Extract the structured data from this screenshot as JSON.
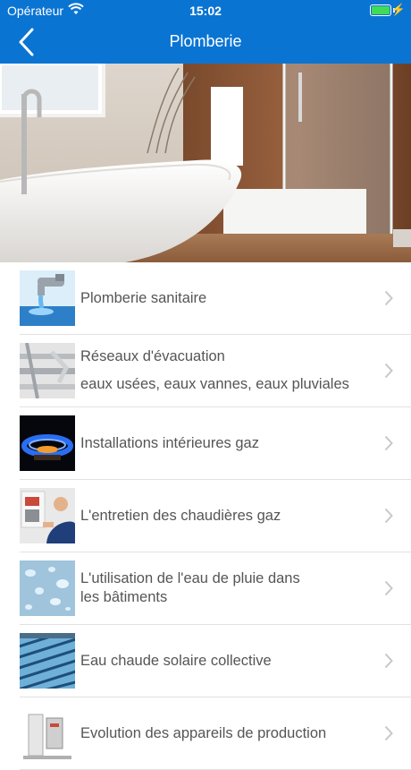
{
  "status_bar": {
    "carrier": "Opérateur",
    "time": "15:02"
  },
  "header": {
    "title": "Plomberie"
  },
  "items": [
    {
      "lines": [
        "Plomberie sanitaire"
      ],
      "icon": "faucet-water-icon"
    },
    {
      "lines": [
        "Réseaux d'évacuation",
        "eaux usées, eaux vannes, eaux pluviales"
      ],
      "icon": "pipes-icon"
    },
    {
      "lines": [
        "Installations intérieures gaz"
      ],
      "icon": "gas-flame-icon"
    },
    {
      "lines": [
        "L'entretien des chaudières gaz"
      ],
      "icon": "technician-boiler-icon"
    },
    {
      "lines": [
        "L'utilisation de l'eau de pluie dans",
        "les bâtiments"
      ],
      "icon": "water-drops-icon"
    },
    {
      "lines": [
        "Eau chaude solaire collective"
      ],
      "icon": "solar-panel-icon"
    },
    {
      "lines": [
        "Evolution des appareils de production"
      ],
      "icon": "water-heater-icon"
    }
  ],
  "colors": {
    "accent": "#0a74d3",
    "text": "#555555",
    "separator": "#e2e2e2"
  }
}
